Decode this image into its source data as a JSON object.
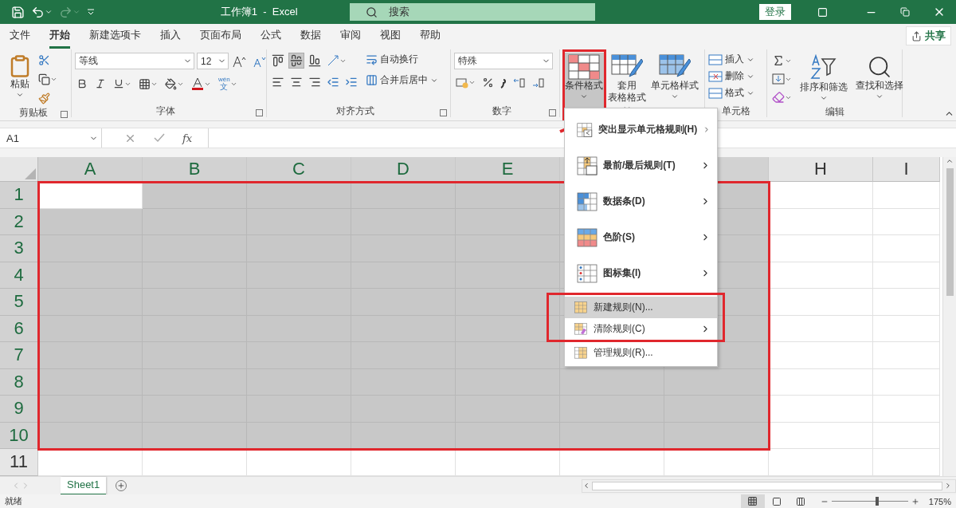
{
  "title_bar": {
    "title": "工作簿1  -  Excel",
    "search_placeholder": "搜索",
    "sign_in": "登录",
    "redo_disabled": true
  },
  "tabs": [
    {
      "label": "文件",
      "selected": false
    },
    {
      "label": "开始",
      "selected": true
    },
    {
      "label": "新建选项卡",
      "selected": false
    },
    {
      "label": "插入",
      "selected": false
    },
    {
      "label": "页面布局",
      "selected": false
    },
    {
      "label": "公式",
      "selected": false
    },
    {
      "label": "数据",
      "selected": false
    },
    {
      "label": "审阅",
      "selected": false
    },
    {
      "label": "视图",
      "selected": false
    },
    {
      "label": "帮助",
      "selected": false
    }
  ],
  "share": "共享",
  "ribbon": [
    {
      "kind": "clipboard",
      "label": "剪贴板",
      "paste": "粘贴"
    },
    {
      "kind": "font",
      "label": "字体",
      "font": "等线",
      "size": "12",
      "phonetic_top": "wén",
      "phonetic_bottom": "文"
    },
    {
      "kind": "alignment",
      "label": "对齐方式",
      "wrap": "自动换行",
      "merge": "合并后居中",
      "valign": [
        {
          "selected": false
        },
        {
          "selected": true
        },
        {
          "selected": false
        }
      ]
    },
    {
      "kind": "number",
      "label": "数字",
      "format": "特殊"
    },
    {
      "kind": "styles",
      "buttons": [
        {
          "lines": [
            "条件格式"
          ],
          "pressed": true,
          "annotated": true
        },
        {
          "lines": [
            "套用",
            "表格格式"
          ],
          "pressed": false,
          "annotated": false
        },
        {
          "lines": [
            "单元格样式"
          ],
          "pressed": false,
          "annotated": false
        }
      ]
    },
    {
      "kind": "cells",
      "label": "单元格",
      "items": [
        "插入",
        "删除",
        "格式"
      ]
    },
    {
      "kind": "editing",
      "label": "编辑",
      "sort": "排序和筛选",
      "find": "查找和选择"
    }
  ],
  "formula_bar": {
    "name_box": "A1",
    "function_label": "fx"
  },
  "grid": {
    "columns": [
      {
        "label": "A",
        "selected": true
      },
      {
        "label": "B",
        "selected": true
      },
      {
        "label": "C",
        "selected": true
      },
      {
        "label": "D",
        "selected": true
      },
      {
        "label": "E",
        "selected": true
      },
      {
        "selected": true
      },
      {
        "selected": true
      },
      {
        "label": "H",
        "selected": false
      },
      {
        "label": "I",
        "selected": false
      }
    ],
    "rows": [
      {
        "label": "1",
        "selected": true
      },
      {
        "label": "2",
        "selected": true
      },
      {
        "label": "3",
        "selected": true
      },
      {
        "label": "4",
        "selected": true
      },
      {
        "label": "5",
        "selected": true
      },
      {
        "label": "6",
        "selected": true
      },
      {
        "label": "7",
        "selected": true
      },
      {
        "label": "8",
        "selected": true
      },
      {
        "label": "9",
        "selected": true
      },
      {
        "label": "10",
        "selected": true
      },
      {
        "label": "11",
        "selected": false
      }
    ],
    "selection_annotated": true
  },
  "menu": [
    {
      "kind": "large",
      "label": "突出显示单元格规则(H)",
      "submenu": true,
      "selected": false,
      "annotated": false
    },
    {
      "kind": "large",
      "label": "最前/最后规则(T)",
      "submenu": true,
      "selected": false,
      "annotated": false
    },
    {
      "kind": "large",
      "label": "数据条(D)",
      "submenu": true,
      "selected": false,
      "annotated": false
    },
    {
      "kind": "large",
      "label": "色阶(S)",
      "submenu": true,
      "selected": false,
      "annotated": false
    },
    {
      "kind": "large",
      "label": "图标集(I)",
      "submenu": true,
      "selected": false,
      "annotated": false
    },
    {
      "kind": "small",
      "label": "新建规则(N)...",
      "submenu": false,
      "selected": true,
      "annotated": true
    },
    {
      "kind": "small",
      "label": "清除规则(C)",
      "submenu": true,
      "selected": false,
      "annotated": true
    },
    {
      "kind": "small",
      "label": "管理规则(R)...",
      "submenu": false,
      "selected": false,
      "annotated": false
    }
  ],
  "sheets": [
    {
      "label": "Sheet1",
      "selected": true
    }
  ],
  "status_bar": {
    "status": "就绪",
    "views": [
      {
        "kind": "normal",
        "selected": true
      },
      {
        "kind": "layout",
        "selected": false
      },
      {
        "kind": "break",
        "selected": false
      }
    ],
    "zoom": {
      "level": 0.6
    },
    "zoom_text": "175%"
  }
}
